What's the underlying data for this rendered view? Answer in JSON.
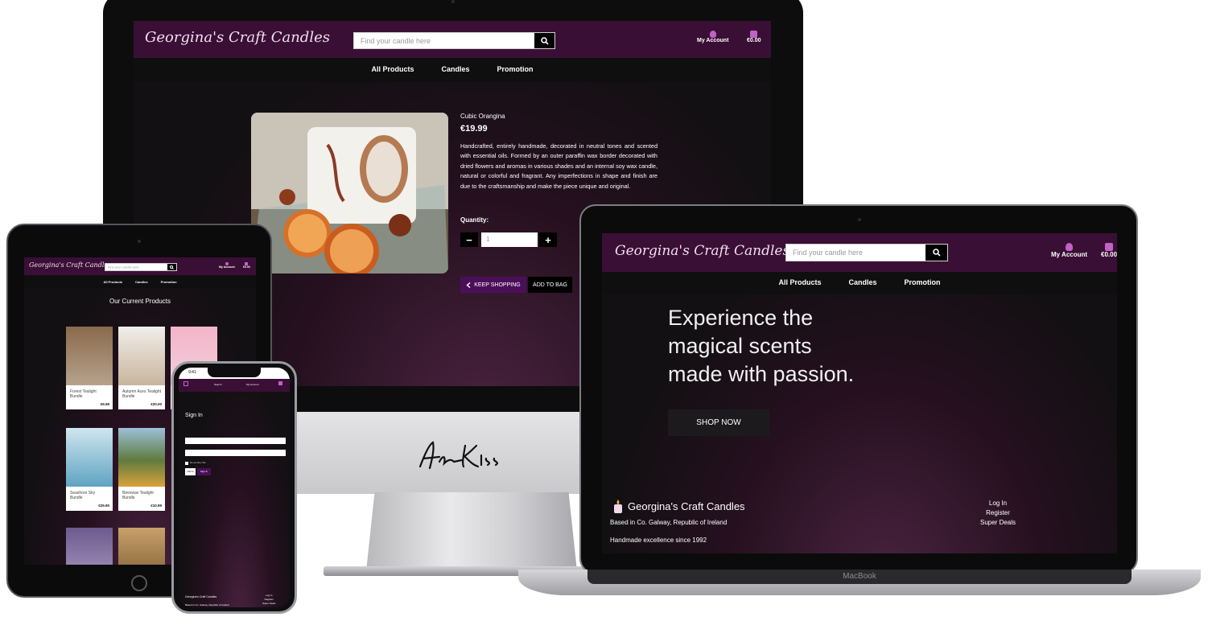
{
  "brand": {
    "name": "Georgina's Craft Candles",
    "colors": {
      "header": "#3a0f35",
      "subnav": "#0f0f10",
      "accent": "#4b0f5a",
      "icon": "#c261c6"
    }
  },
  "header": {
    "search_placeholder": "Find your candle here",
    "search_icon": "search-icon",
    "account_label": "My Account",
    "bag_total": "€0.00"
  },
  "nav": {
    "items": [
      "All Products",
      "Candles",
      "Promotion"
    ]
  },
  "product": {
    "name": "Cubic Orangina",
    "price": "€19.99",
    "description": "Handcrafted, entirely handmade, decorated in neutral tones and scented with essential oils. Formed by an outer paraffin wax border decorated with dried flowers and aromas in various shades and an internal soy wax candle, natural or colorful and fragrant. Any imperfections in shape and finish are due to the craftsmanship and make the piece unique and original.",
    "quantity_label": "Quantity:",
    "quantity_value": "1",
    "minus": "−",
    "plus": "+",
    "keep_shopping": "KEEP SHOPPING",
    "add_to_bag": "ADD TO BAG"
  },
  "home": {
    "hero": [
      "Experience the",
      "magical scents",
      "made with passion."
    ],
    "cta": "SHOP NOW",
    "footer": {
      "brand": "Georgina's Craft Candles",
      "location": "Based in Co. Galway, Republic of Ireland",
      "since": "Handmade excellence since 1992",
      "links": [
        "Log In",
        "Register",
        "Super Deals"
      ]
    }
  },
  "products_page": {
    "heading": "Our Current Products",
    "cards": [
      {
        "title": "Forest Tealight Bundle",
        "price": "€9.99"
      },
      {
        "title": "Autumn Aces Tealight Bundle",
        "price": "€20.00"
      },
      {
        "title": "",
        "price": ""
      },
      {
        "title": "Seashore Sky Bundle",
        "price": "€25.90"
      },
      {
        "title": "Beeswax Tealight Bundle",
        "price": "€10.99"
      }
    ]
  },
  "phone": {
    "time": "9:41",
    "nav": [
      "Search",
      "My Account"
    ],
    "signin_title": "Sign In",
    "remember": "Remember Me",
    "home_btn": "Home",
    "signin_btn": "Sign In",
    "footer_brand": "Georgina's Craft Candles",
    "footer_location": "Based in Co. Galway, Republic of Ireland",
    "footer_links": [
      "Log In",
      "Register",
      "Super Deals"
    ]
  },
  "devices": {
    "laptop_label": "MacBook"
  }
}
